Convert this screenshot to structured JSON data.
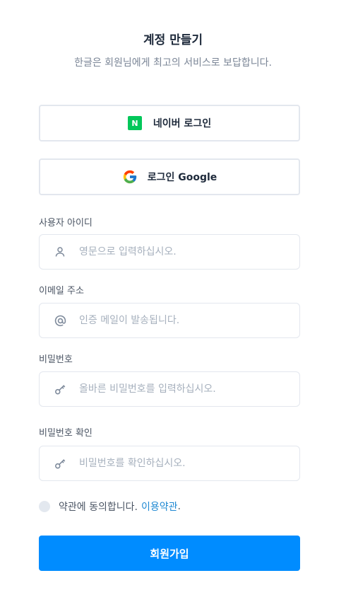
{
  "header": {
    "title": "계정 만들기",
    "subtitle": "한글은 회원님에게 최고의 서비스로 보답합니다."
  },
  "social": {
    "naver": {
      "icon_text": "N",
      "label": "네이버 로그인",
      "icon_color": "#03c75a"
    },
    "google": {
      "label": "로그인 Google"
    }
  },
  "form": {
    "username": {
      "label": "사용자 아이디",
      "placeholder": "영문으로 입력하십시오.",
      "icon": "user-icon"
    },
    "email": {
      "label": "이메일 주소",
      "placeholder": "인증 메일이 발송됩니다.",
      "icon": "at-icon"
    },
    "password": {
      "label": "비밀번호",
      "placeholder": "올바른 비밀번호를 입력하십시오.",
      "icon": "key-icon"
    },
    "password_confirm": {
      "label": "비밀번호 확인",
      "placeholder": "비밀번호를 확인하십시오.",
      "icon": "key-icon"
    }
  },
  "agreement": {
    "text": "약관에 동의합니다.",
    "link": "이용약관",
    "suffix": ".",
    "checked": false
  },
  "submit": {
    "label": "회원가입",
    "color": "#008cff"
  }
}
